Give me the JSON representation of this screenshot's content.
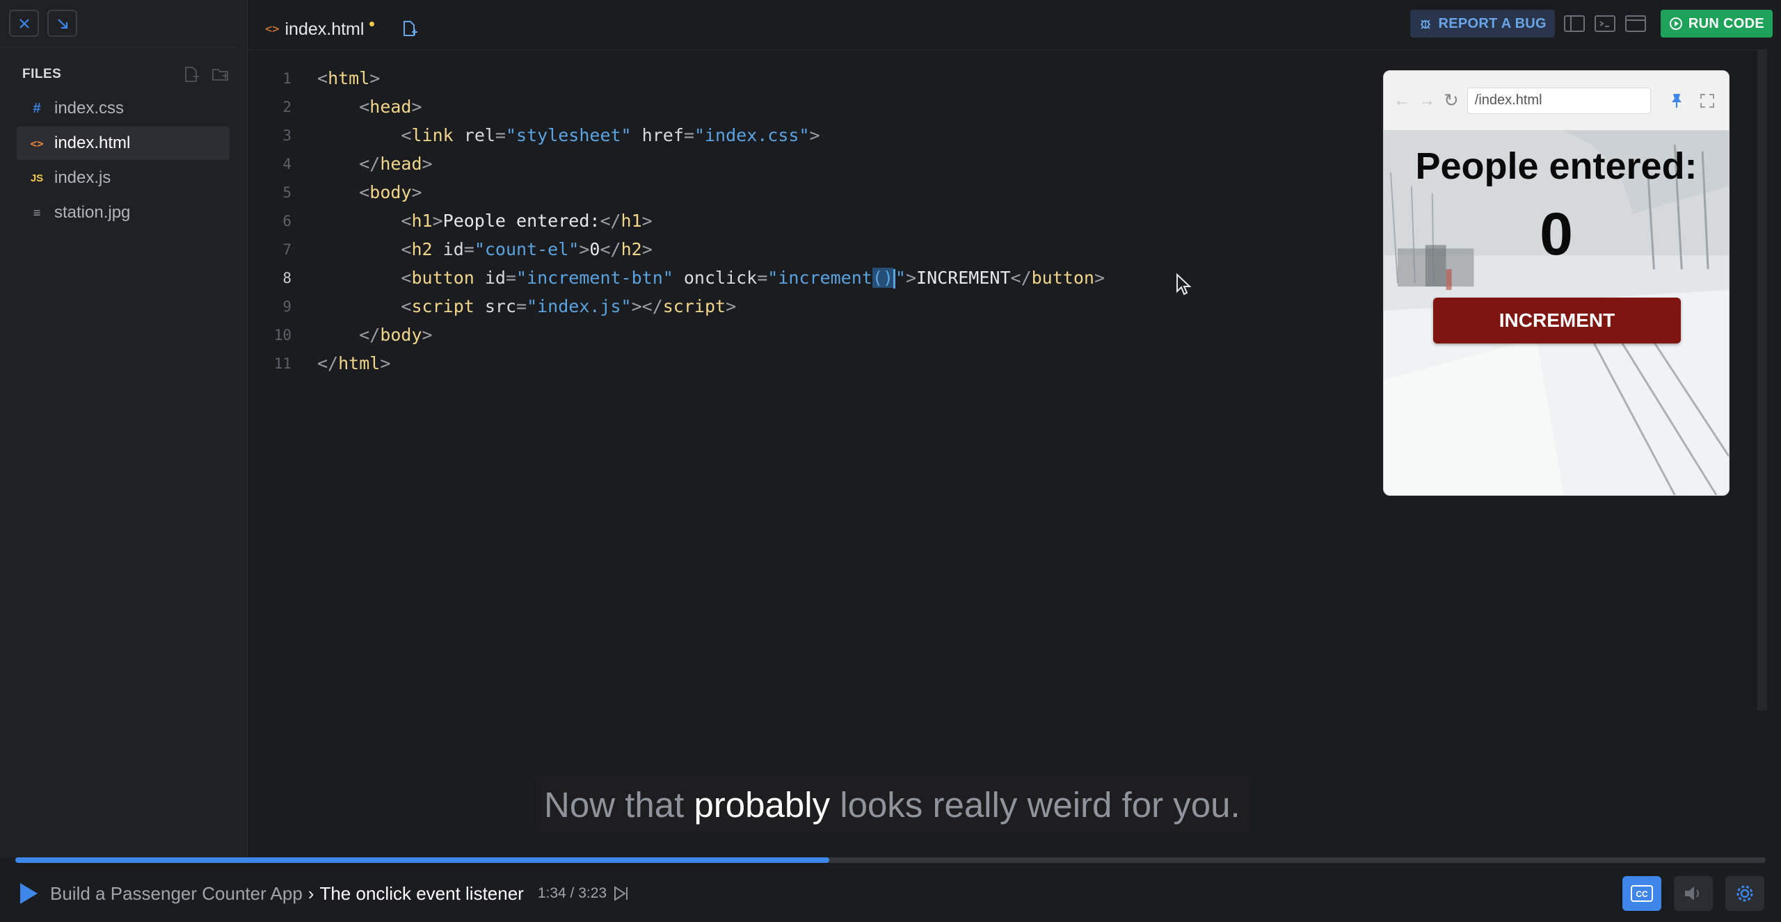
{
  "sidebar": {
    "files_title": "FILES",
    "files": [
      {
        "icon": "#",
        "name": "index.css",
        "icon_color": "#3f86ea"
      },
      {
        "icon": "<>",
        "name": "index.html",
        "icon_color": "#e8833a",
        "active": true
      },
      {
        "icon": "JS",
        "name": "index.js",
        "icon_color": "#f2c94c"
      },
      {
        "icon": "≡",
        "name": "station.jpg",
        "icon_color": "#9aa0a8"
      }
    ]
  },
  "editor": {
    "tab": {
      "icon": "<>",
      "label": "index.html",
      "unsaved": true
    },
    "line_numbers": [
      "1",
      "2",
      "3",
      "4",
      "5",
      "6",
      "7",
      "8",
      "9",
      "10",
      "11"
    ]
  },
  "toolbar": {
    "report_bug": "REPORT A BUG",
    "run_code": "RUN CODE"
  },
  "preview": {
    "url": "/index.html",
    "h1": "People entered:",
    "count": "0",
    "button": "INCREMENT"
  },
  "caption": {
    "before": "Now that ",
    "highlight": "probably",
    "after": " looks really weird for you."
  },
  "player": {
    "course": "Build a Passenger Counter App",
    "separator": "›",
    "lesson": "The onclick event listener",
    "time": "1:34 / 3:23",
    "progress": 0.465
  },
  "colors": {
    "accent": "#3f86ea",
    "run_green": "#1ea25a",
    "button_red": "#7e1511"
  }
}
